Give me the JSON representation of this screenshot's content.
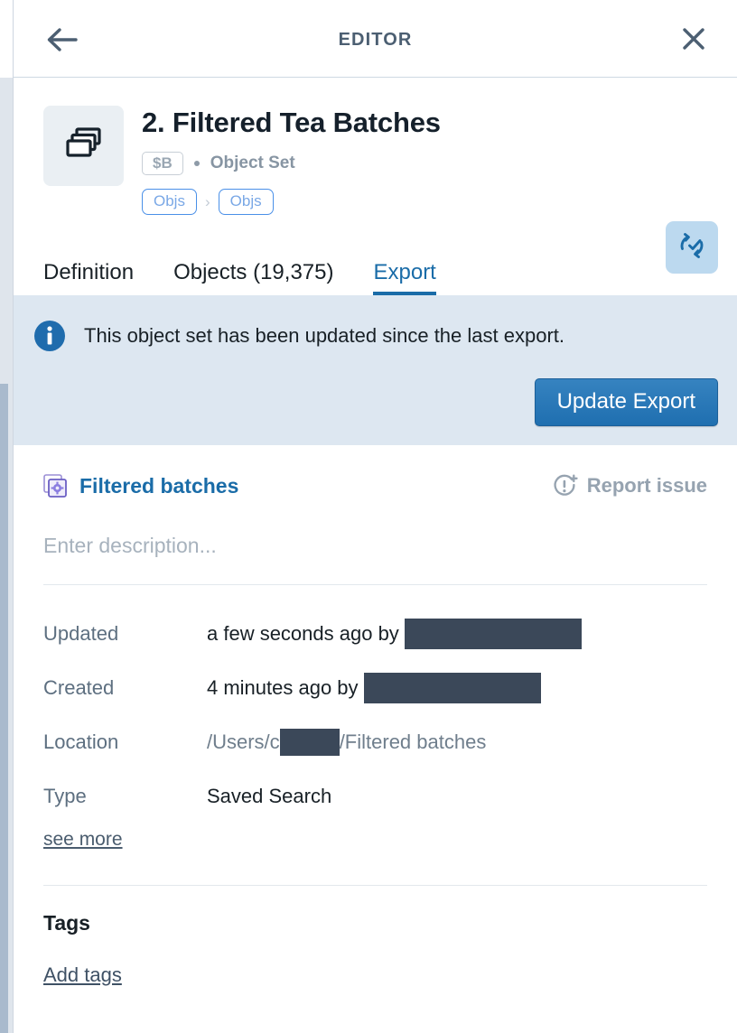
{
  "header": {
    "title": "EDITOR",
    "back_icon": "arrow-left-icon",
    "close_icon": "close-icon"
  },
  "object": {
    "icon": "stacked-cards-icon",
    "title": "2. Filtered Tea Batches",
    "badge": "$B",
    "separator": "•",
    "type_label": "Object Set",
    "path": {
      "from": "Objs",
      "chevron": "›",
      "to": "Objs"
    },
    "sync_icon": "sync-check-icon"
  },
  "tabs": [
    {
      "label": "Definition",
      "active": false
    },
    {
      "label": "Objects (19,375)",
      "active": false
    },
    {
      "label": "Export",
      "active": true
    }
  ],
  "banner": {
    "icon": "info-circle-icon",
    "message": "This object set has been updated since the last export.",
    "action_label": "Update Export"
  },
  "details": {
    "saved_search": {
      "icon": "saved-search-icon",
      "name": "Filtered batches"
    },
    "report_issue": {
      "icon": "report-issue-icon",
      "label": "Report issue"
    },
    "description_placeholder": "Enter description...",
    "rows": [
      {
        "label": "Updated",
        "value": "a few seconds ago by",
        "redacted": true
      },
      {
        "label": "Created",
        "value": "4 minutes ago by",
        "redacted": true
      },
      {
        "label": "Location",
        "value": "/Users/c",
        "value_tail": "/Filtered batches",
        "redacted_inline": true
      },
      {
        "label": "Type",
        "value": "Saved Search",
        "redacted": false
      }
    ],
    "see_more_label": "see more"
  },
  "tags": {
    "title": "Tags",
    "add_label": "Add tags"
  },
  "colors": {
    "accent": "#1a6ca8",
    "banner_bg": "#dde7f1",
    "redaction": "#3b4859",
    "pill_border": "#4a90e8"
  }
}
